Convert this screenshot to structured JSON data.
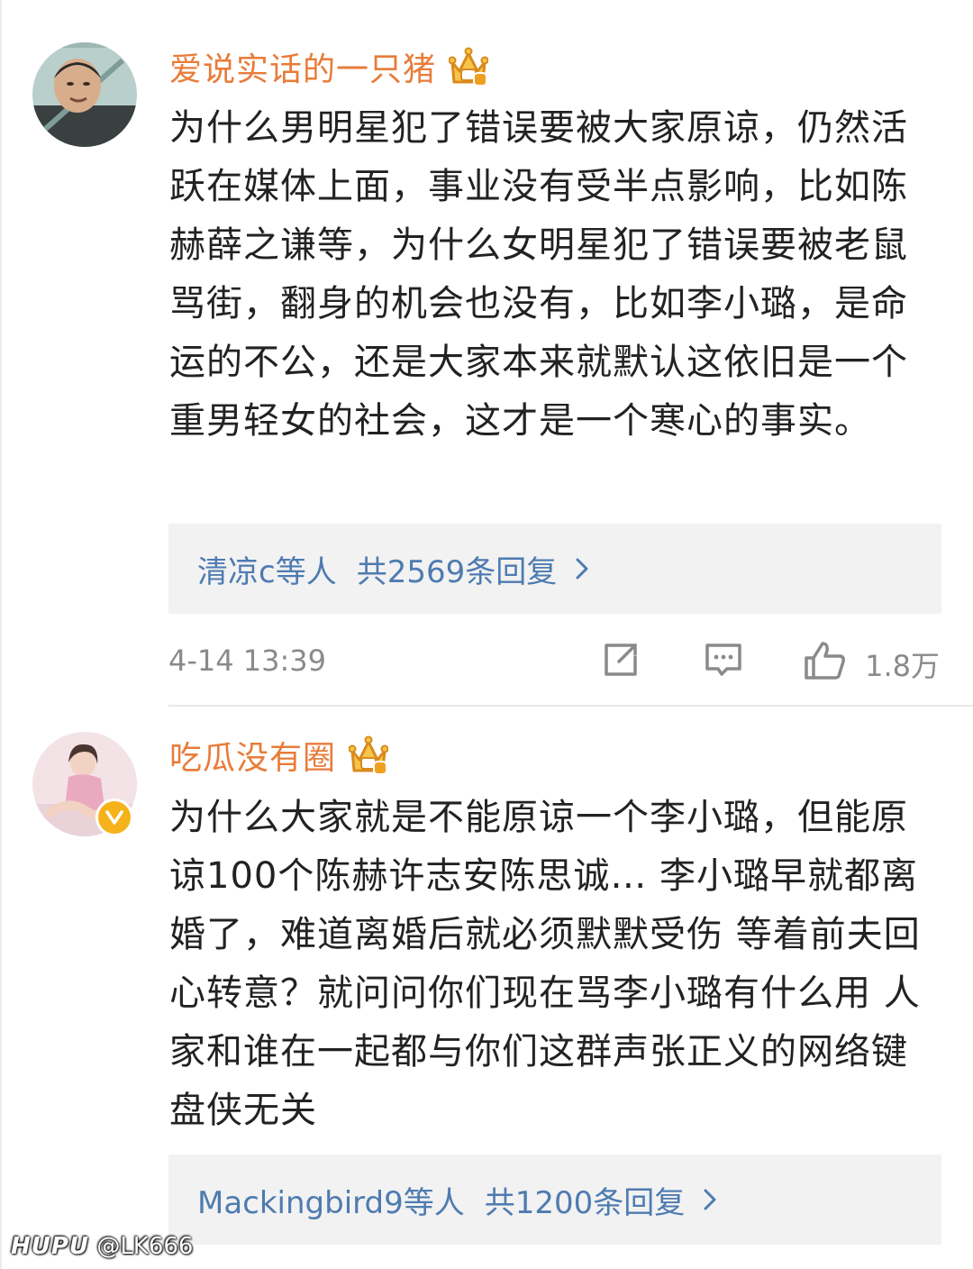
{
  "comments": [
    {
      "username": "爱说实话的一只猪",
      "content": "为什么男明星犯了错误要被大家原谅，仍然活跃在媒体上面，事业没有受半点影响，比如陈赫薛之谦等，为什么女明星犯了错误要被老鼠骂街，翻身的机会也没有，比如李小璐，是命运的不公，还是大家本来就默认这依旧是一个重男轻女的社会，这才是一个寒心的事实。",
      "reply_names": "清凉c等人",
      "reply_count": "共2569条回复",
      "timestamp": "4-14 13:39",
      "likes": "1.8万"
    },
    {
      "username": "吃瓜没有圈",
      "content": "为什么大家就是不能原谅一个李小璐，但能原谅100个陈赫许志安陈思诚… 李小璐早就都离婚了，难道离婚后就必须默默受伤 等着前夫回心转意？就问问你们现在骂李小璐有什么用 人家和谁在一起都与你们这群声张正义的网络键盘侠无关",
      "reply_names": "Mackingbird9等人",
      "reply_count": "共1200条回复"
    }
  ],
  "watermark": {
    "brand": "HUPU",
    "user": "@LK666"
  },
  "colors": {
    "username": "#e87c3a",
    "link": "#4e7bb0",
    "meta": "#8a8a8a",
    "reply_bg": "#f2f2f2",
    "crown": "#f5b21a"
  },
  "icons": [
    "crown-badge-icon",
    "verified-icon",
    "chevron-right-icon",
    "share-icon",
    "comment-icon",
    "like-icon"
  ]
}
